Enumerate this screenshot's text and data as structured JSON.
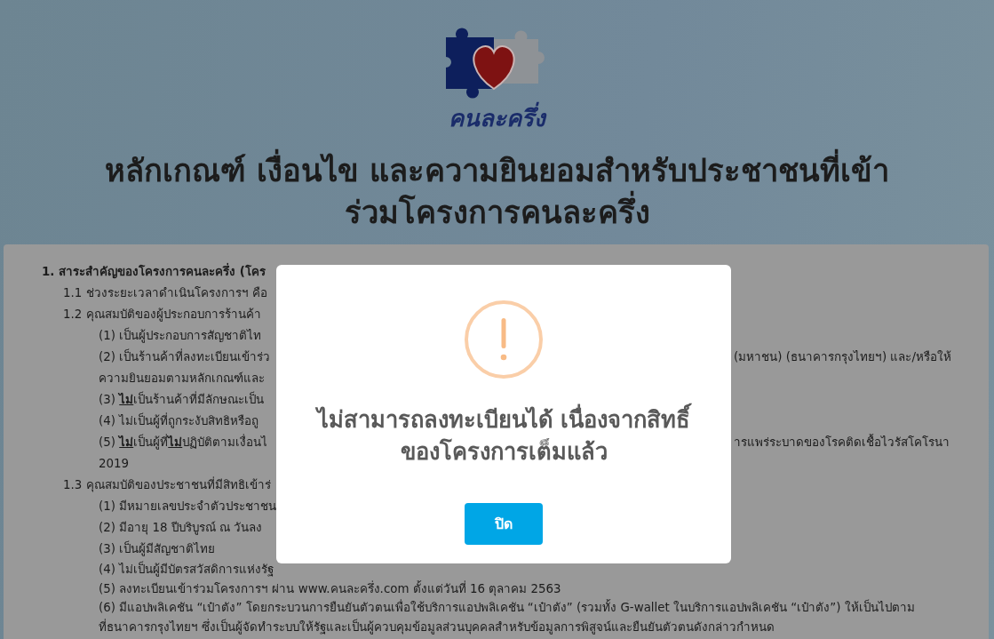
{
  "logo": {
    "text": "คนละครึ่ง"
  },
  "title": "หลักเกณฑ์ เงื่อนไข และความยินยอมสำหรับประชาชนที่เข้าร่วมโครงการคนละครึ่ง",
  "document": {
    "sections": [
      {
        "heading": "1. สาระสำคัญของโครงการคนละครึ่ง (โคร",
        "children": [
          {
            "lines": [
              {
                "text": "1.1 ช่วงระยะเวลาดำเนินโครงการฯ คือ"
              }
            ]
          },
          {
            "lines": [
              {
                "text": "1.2 คุณสมบัติของผู้ประกอบการร้านค้า"
              }
            ],
            "children": [
              {
                "lines": [
                  {
                    "text": "(1) เป็นผู้ประกอบการสัญชาติไท"
                  }
                ]
              },
              {
                "lines": [
                  {
                    "text": "(2) เป็นร้านค้าที่ลงทะเบียนเข้าร่ว",
                    "right_text": "(มหาชน) (ธนาคารกรุงไทยฯ) และ/หรือให้"
                  },
                  {
                    "text": "ความยินยอมตามหลักเกณฑ์และ"
                  }
                ]
              },
              {
                "lines": [
                  {
                    "text": "(3) **ไม่**เป็นร้านค้าที่มีลักษณะเป็น"
                  }
                ]
              },
              {
                "lines": [
                  {
                    "text": "(4) ไม่เป็นผู้ที่ถูกระงับสิทธิหรือถู"
                  }
                ]
              },
              {
                "lines": [
                  {
                    "text": "(5) **ไม่**เป็นผู้ที่**ไม่**ปฏิบัติตามเงื่อนไ",
                    "right_text": "ารแพร่ระบาดของโรคติดเชื้อไวรัสโคโรนา"
                  },
                  {
                    "text": "2019"
                  }
                ]
              }
            ]
          },
          {
            "lines": [
              {
                "text": "1.3 คุณสมบัติของประชาชนที่มีสิทธิเข้าร่"
              }
            ],
            "children": [
              {
                "lines": [
                  {
                    "text": "(1) มีหมายเลขประจำตัวประชาชน"
                  }
                ]
              },
              {
                "lines": [
                  {
                    "text": "(2) มีอายุ 18 ปีบริบูรณ์ ณ วันลง"
                  }
                ]
              },
              {
                "lines": [
                  {
                    "text": "(3) เป็นผู้มีสัญชาติไทย"
                  }
                ]
              },
              {
                "lines": [
                  {
                    "text": "(4) ไม่เป็นผู้มีบัตรสวัสดิการแห่งรัฐ"
                  }
                ]
              },
              {
                "lines": [
                  {
                    "text": "(5) ลงทะเบียนเข้าร่วมโครงการฯ ผ่าน www.คนละครึ่ง.com ตั้งแต่วันที่ 16 ตุลาคม 2563"
                  }
                ]
              },
              {
                "lines": [
                  {
                    "text": "(6) มีแอปพลิเคชัน “เป๋าตัง” โดยกระบวนการยืนยันตัวตนเพื่อใช้บริการแอปพลิเคชัน “เป๋าตัง” (รวมทั้ง G-wallet ในบริการแอปพลิเคชัน “เป๋าตัง”) ให้เป็นไปตาม"
                  },
                  {
                    "text": "ที่ธนาคารกรุงไทยฯ ซึ่งเป็นผู้จัดทำระบบให้รัฐและเป็นผู้ควบคุมข้อมูลส่วนบุคคลสำหรับข้อมูลการพิสูจน์และยืนยันตัวตนดังกล่าวกำหนด"
                  }
                ]
              }
            ]
          }
        ]
      }
    ]
  },
  "dialog": {
    "kind": "warning",
    "title": "ไม่สามารถลงทะเบียนได้ เนื่องจากสิทธิ์ของโครงการเต็มแล้ว",
    "buttons": [
      {
        "label": "ปิด"
      }
    ]
  }
}
